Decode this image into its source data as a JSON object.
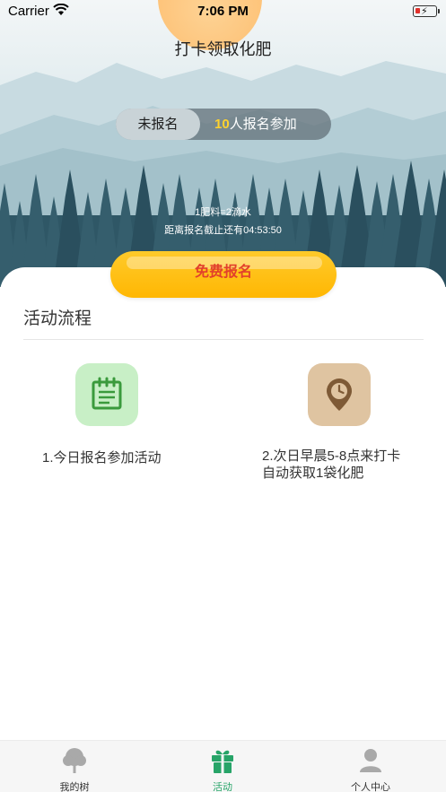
{
  "status_bar": {
    "carrier": "Carrier",
    "time": "7:06 PM"
  },
  "header": {
    "title": "打卡领取化肥"
  },
  "toggle": {
    "not_registered": "未报名",
    "count": "10",
    "count_suffix": "人报名参加"
  },
  "info": {
    "exchange_rate": "1肥料=2滴水",
    "deadline": "距离报名截止还有04:53:50"
  },
  "signup_button": {
    "label": "免费报名"
  },
  "process": {
    "title": "活动流程",
    "steps": [
      {
        "icon": "notepad-icon",
        "text": "1.今日报名参加活动"
      },
      {
        "icon": "clock-pin-icon",
        "line1": "2.次日早晨5-8点来打卡",
        "line2": "自动获取1袋化肥"
      }
    ]
  },
  "tabbar": {
    "items": [
      {
        "label": "我的树",
        "icon": "tree-icon",
        "active": false
      },
      {
        "label": "活动",
        "icon": "gift-icon",
        "active": true
      },
      {
        "label": "个人中心",
        "icon": "person-icon",
        "active": false
      }
    ]
  },
  "colors": {
    "accent_green": "#27a468",
    "button_yellow": "#ffbb0f",
    "count_yellow": "#ffd22e",
    "button_text_red": "#e2402b"
  }
}
